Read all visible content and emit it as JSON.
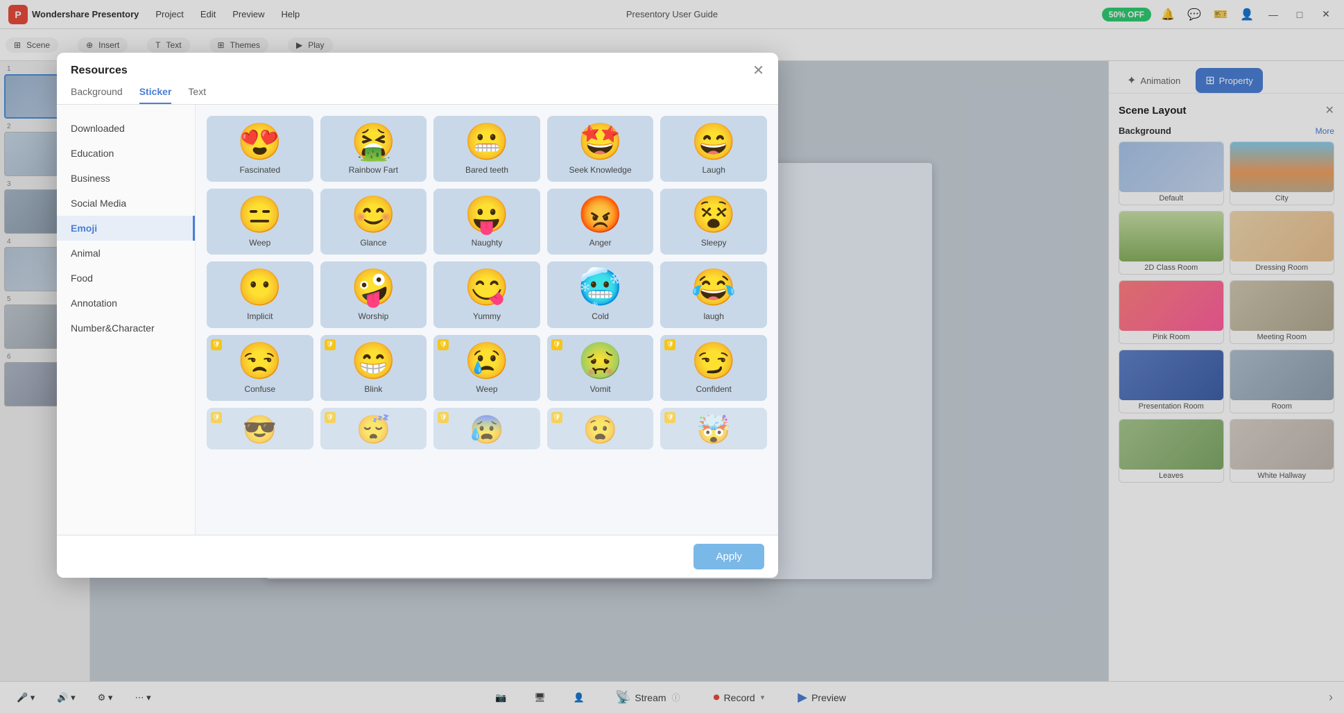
{
  "app": {
    "logo": "P",
    "name": "Wondershare Presentory",
    "nav": [
      "Project",
      "Edit",
      "Preview",
      "Help"
    ],
    "center_title": "Presentory User Guide",
    "discount": "50% OFF",
    "window_buttons": [
      "—",
      "□",
      "✕"
    ]
  },
  "right_panel": {
    "tabs": [
      {
        "id": "animation",
        "label": "Animation",
        "icon": "✦"
      },
      {
        "id": "property",
        "label": "Property",
        "icon": "⊞"
      }
    ],
    "active_tab": "property",
    "scene_layout": {
      "title": "Scene Layout",
      "background_section": "Background",
      "more_label": "More",
      "items": [
        {
          "id": "default",
          "label": "Default",
          "style": "bg-default"
        },
        {
          "id": "city",
          "label": "City",
          "style": "bg-city"
        },
        {
          "id": "class-room",
          "label": "2D Class Room",
          "style": "bg-class"
        },
        {
          "id": "dressing-room",
          "label": "Dressing Room",
          "style": "bg-dressing"
        },
        {
          "id": "pink-room",
          "label": "Pink Room",
          "style": "bg-pink"
        },
        {
          "id": "meeting-room",
          "label": "Meeting Room",
          "style": "bg-meeting"
        },
        {
          "id": "presentation-room",
          "label": "Presentation Room",
          "style": "bg-presentation"
        },
        {
          "id": "room",
          "label": "Room",
          "style": "bg-room"
        },
        {
          "id": "leaves",
          "label": "Leaves",
          "style": "bg-leaves"
        },
        {
          "id": "white-hallway",
          "label": "White Hallway",
          "style": "bg-hallway"
        }
      ]
    }
  },
  "dialog": {
    "title": "Resources",
    "close_label": "✕",
    "tabs": [
      "Background",
      "Sticker",
      "Text"
    ],
    "active_tab": "Sticker",
    "categories": [
      {
        "id": "downloaded",
        "label": "Downloaded"
      },
      {
        "id": "education",
        "label": "Education"
      },
      {
        "id": "business",
        "label": "Business"
      },
      {
        "id": "social-media",
        "label": "Social Media"
      },
      {
        "id": "emoji",
        "label": "Emoji",
        "active": true
      },
      {
        "id": "animal",
        "label": "Animal"
      },
      {
        "id": "food",
        "label": "Food"
      },
      {
        "id": "annotation",
        "label": "Annotation"
      },
      {
        "id": "number-char",
        "label": "Number&Character"
      }
    ],
    "emojis": [
      {
        "id": "fascinated",
        "label": "Fascinated",
        "face": "😍",
        "premium": false
      },
      {
        "id": "rainbow-fart",
        "label": "Rainbow Fart",
        "face": "🤮",
        "premium": false
      },
      {
        "id": "bared-teeth",
        "label": "Bared teeth",
        "face": "😬",
        "premium": false
      },
      {
        "id": "seek-knowledge",
        "label": "Seek Knowledge",
        "face": "🤩",
        "premium": false
      },
      {
        "id": "laugh",
        "label": "Laugh",
        "face": "😄",
        "premium": false
      },
      {
        "id": "weep",
        "label": "Weep",
        "face": "😐",
        "premium": false
      },
      {
        "id": "glance",
        "label": "Glance",
        "face": "😊",
        "premium": false
      },
      {
        "id": "naughty",
        "label": "Naughty",
        "face": "😛",
        "premium": false
      },
      {
        "id": "anger",
        "label": "Anger",
        "face": "🤬",
        "premium": false
      },
      {
        "id": "sleepy",
        "label": "Sleepy",
        "face": "😵",
        "premium": false
      },
      {
        "id": "implicit",
        "label": "Implicit",
        "face": "😶",
        "premium": false
      },
      {
        "id": "worship",
        "label": "Worship",
        "face": "🤪",
        "premium": false
      },
      {
        "id": "yummy",
        "label": "Yummy",
        "face": "😋",
        "premium": false
      },
      {
        "id": "cold",
        "label": "Cold",
        "face": "🥶",
        "premium": false
      },
      {
        "id": "laugh2",
        "label": "laugh",
        "face": "😂",
        "premium": false
      },
      {
        "id": "confuse",
        "label": "Confuse",
        "face": "😒",
        "premium": true
      },
      {
        "id": "blink",
        "label": "Blink",
        "face": "😁",
        "premium": true
      },
      {
        "id": "weep2",
        "label": "Weep",
        "face": "😢",
        "premium": true
      },
      {
        "id": "vomit",
        "label": "Vomit",
        "face": "🤢",
        "premium": true
      },
      {
        "id": "confident",
        "label": "Confident",
        "face": "😏",
        "premium": true
      },
      {
        "id": "partial1",
        "label": "",
        "face": "😎",
        "premium": true
      },
      {
        "id": "partial2",
        "label": "",
        "face": "😴",
        "premium": true
      },
      {
        "id": "partial3",
        "label": "",
        "face": "😰",
        "premium": true
      },
      {
        "id": "partial4",
        "label": "",
        "face": "😧",
        "premium": true
      },
      {
        "id": "partial5",
        "label": "",
        "face": "🤯",
        "premium": true
      }
    ],
    "apply_label": "Apply"
  },
  "bottom_bar": {
    "stream_label": "Stream",
    "record_label": "Record",
    "preview_label": "Preview"
  },
  "slides": [
    {
      "num": "1",
      "style": "sp1",
      "active": true
    },
    {
      "num": "2",
      "style": "sp2",
      "active": false
    },
    {
      "num": "3",
      "style": "sp3",
      "active": false
    },
    {
      "num": "4",
      "style": "sp4",
      "active": false
    },
    {
      "num": "5",
      "style": "sp5",
      "active": false
    },
    {
      "num": "6",
      "style": "sp6",
      "active": false
    }
  ]
}
